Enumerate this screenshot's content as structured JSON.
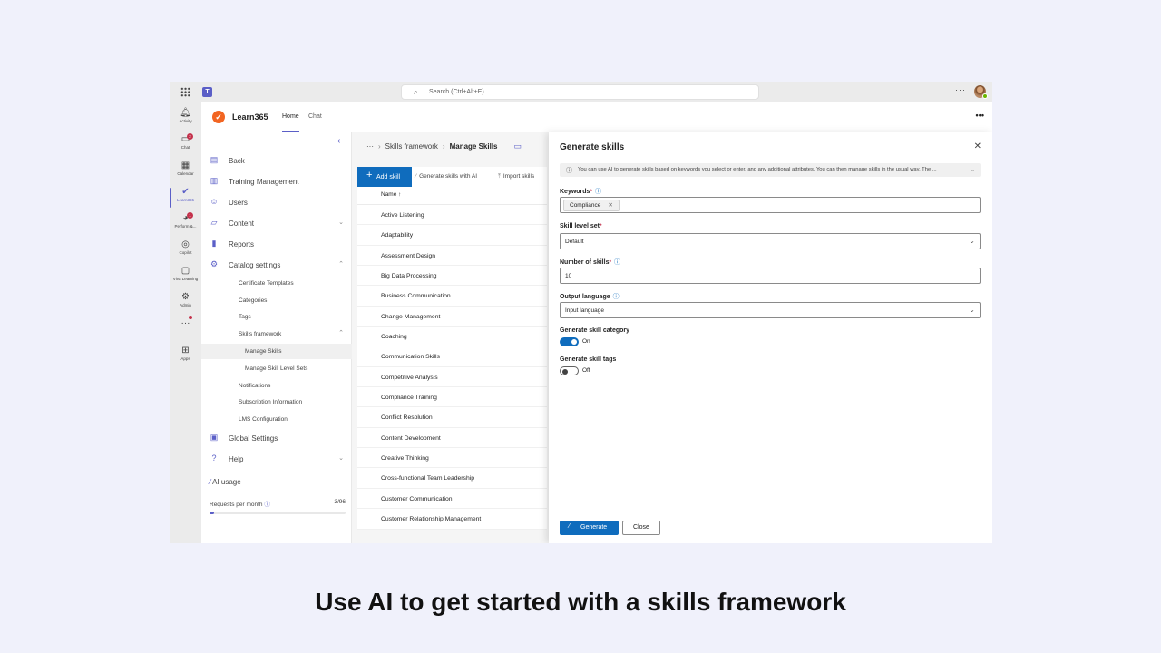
{
  "topbar": {
    "search_placeholder": "Search (Ctrl+Alt+E)",
    "more": "···"
  },
  "rail": [
    {
      "label": "Activity",
      "icon": "bell-icon"
    },
    {
      "label": "Chat",
      "icon": "chat-icon",
      "badge": "2"
    },
    {
      "label": "Calendar",
      "icon": "calendar-icon"
    },
    {
      "label": "Learn365",
      "icon": "learn365-icon",
      "active": true
    },
    {
      "label": "Perform &...",
      "icon": "perform-icon",
      "badge": "1"
    },
    {
      "label": "Copilot",
      "icon": "copilot-icon"
    },
    {
      "label": "Viva Learning",
      "icon": "viva-learning-icon"
    },
    {
      "label": "Admin",
      "icon": "admin-icon"
    },
    {
      "label": "",
      "icon": "more-apps-icon"
    },
    {
      "label": "Apps",
      "icon": "apps-icon"
    }
  ],
  "app": {
    "name": "Learn365",
    "tabs": [
      "Home",
      "Chat"
    ],
    "more": "•••"
  },
  "nav": {
    "back": "Back",
    "training_management": "Training Management",
    "users": "Users",
    "content": "Content",
    "reports": "Reports",
    "catalog_settings": "Catalog settings",
    "certificate_templates": "Certificate Templates",
    "categories": "Categories",
    "tags": "Tags",
    "skills_framework": "Skills framework",
    "manage_skills": "Manage Skills",
    "manage_skill_level_sets": "Manage Skill Level Sets",
    "notifications": "Notifications",
    "subscription_information": "Subscription Information",
    "lms_configuration": "LMS Configuration",
    "global_settings": "Global Settings",
    "help": "Help",
    "ai_usage": "AI usage",
    "requests_per_month": "Requests per month",
    "requests_value": "3/96",
    "requests_fraction": 0.03125
  },
  "main": {
    "breadcrumb_ellipsis": "···",
    "breadcrumb_parent": "Skills framework",
    "breadcrumb_current": "Manage Skills",
    "add_skill": "Add skill",
    "generate_ai": "Generate skills with AI",
    "import_skills": "Import skills",
    "col_name": "Name ↑",
    "skills": [
      "Active Listening",
      "Adaptability",
      "Assessment Design",
      "Big Data Processing",
      "Business Communication",
      "Change Management",
      "Coaching",
      "Communication Skills",
      "Competitive Analysis",
      "Compliance Training",
      "Conflict Resolution",
      "Content Development",
      "Creative Thinking",
      "Cross-functional Team Leadership",
      "Customer Communication",
      "Customer Relationship Management"
    ]
  },
  "panel": {
    "title": "Generate skills",
    "info": "You can use AI to generate skills based on keywords you select or enter, and any additional attributes. You can then manage skills in the usual way. The ...",
    "keywords_label": "Keywords",
    "keyword_tag": "Compliance",
    "skill_level_set_label": "Skill level set",
    "skill_level_set_value": "Default",
    "num_skills_label": "Number of skills",
    "num_skills_value": "10",
    "output_language_label": "Output language",
    "output_language_value": "Input language",
    "gen_category_label": "Generate skill category",
    "gen_category_state": "On",
    "gen_tags_label": "Generate skill tags",
    "gen_tags_state": "Off",
    "generate_button": "Generate",
    "close_button": "Close"
  },
  "caption": "Use AI to get started with a skills framework",
  "colors": {
    "brand": "#5b5fc7",
    "primary": "#0f6cbd",
    "learn365": "#f26522",
    "badge": "#c4314b"
  }
}
